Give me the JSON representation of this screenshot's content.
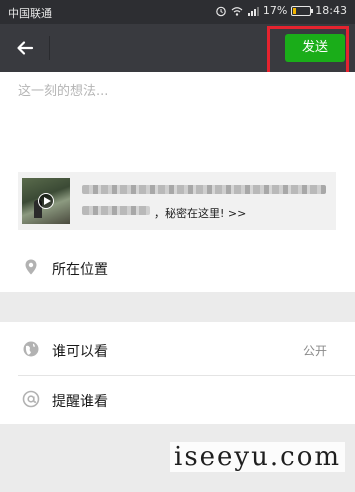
{
  "status_bar": {
    "carrier": "中国联通",
    "alarm_icon": "alarm-clock-icon",
    "wifi_icon": "wifi-icon",
    "signal_icon": "cell-signal-icon",
    "battery_percent": "17%",
    "battery_level": 0.17,
    "time": "18:43"
  },
  "title_bar": {
    "back_icon": "back-arrow-icon",
    "send_label": "发送",
    "send_color": "#1aad19",
    "highlight_color": "#e5232f"
  },
  "compose": {
    "placeholder": "这一刻的想法..."
  },
  "link_card": {
    "visible_text": "，秘密在这里! >>",
    "thumbnail_icon": "video-play-icon"
  },
  "rows": {
    "location": {
      "label": "所在位置",
      "icon": "location-pin-icon"
    },
    "visibility": {
      "label": "谁可以看",
      "value": "公开",
      "icon": "globe-icon"
    },
    "remind": {
      "label": "提醒谁看",
      "icon": "at-sign-icon"
    }
  },
  "watermark": "iseeyu.com"
}
